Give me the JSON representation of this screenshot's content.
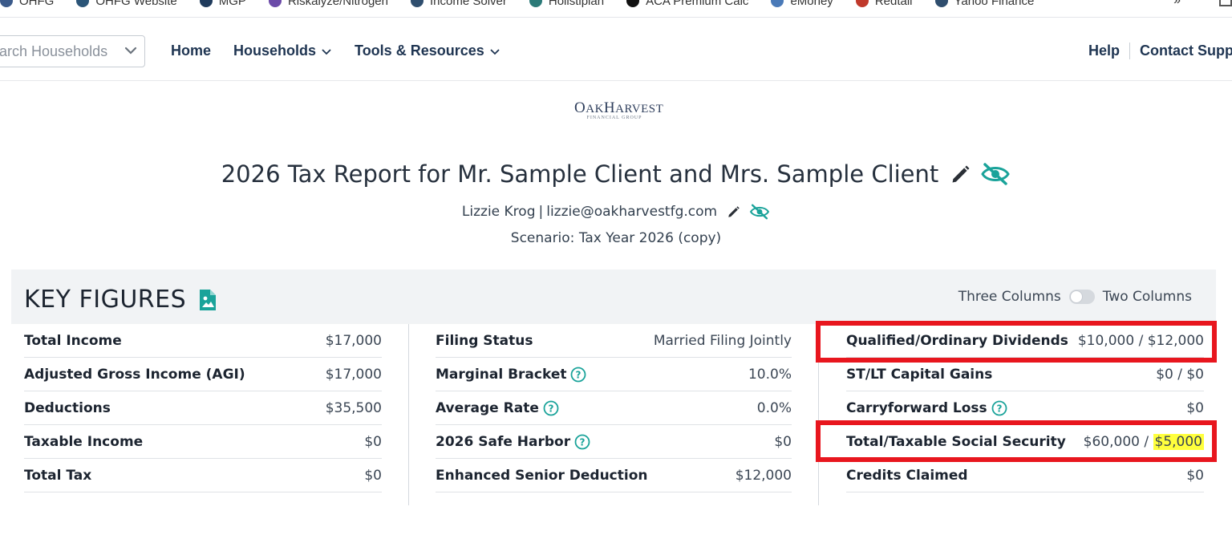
{
  "bookmarks": {
    "items": [
      {
        "label": "OHFG",
        "icon": "ohfg-icon",
        "color": "#3b5a8a"
      },
      {
        "label": "OHFG Website",
        "icon": "ohfg-website-icon",
        "color": "#2b5578"
      },
      {
        "label": "MGP",
        "icon": "mgp-icon",
        "color": "#1f3b5c"
      },
      {
        "label": "Riskalyze/Nitrogen",
        "icon": "nitrogen-icon",
        "color": "#6b4aa8"
      },
      {
        "label": "Income Solver",
        "icon": "income-solver-icon",
        "color": "#2f4e6e"
      },
      {
        "label": "Holistiplan",
        "icon": "holistiplan-icon",
        "color": "#2b7a78"
      },
      {
        "label": "ACA Premium Calc",
        "icon": "kff-icon",
        "color": "#111111"
      },
      {
        "label": "eMoney",
        "icon": "emoney-icon",
        "color": "#4a7ab8"
      },
      {
        "label": "Redtail",
        "icon": "redtail-icon",
        "color": "#c0392b"
      },
      {
        "label": "Yahoo Finance",
        "icon": "yahoo-icon",
        "color": "#2f4e6e"
      }
    ],
    "more": "»"
  },
  "navbar": {
    "search_placeholder": "Search Households",
    "links": {
      "home": "Home",
      "households": "Households",
      "tools": "Tools & Resources"
    },
    "help": "Help",
    "contact": "Contact Support"
  },
  "logo": {
    "main_first": "O",
    "main_rest": "AK",
    "main_second": "H",
    "main_second_rest": "ARVEST",
    "sub": "FINANCIAL GROUP"
  },
  "report": {
    "title": "2026 Tax Report for Mr. Sample Client and Mrs. Sample Client",
    "advisor_name": "Lizzie Krog",
    "separator": "|",
    "advisor_email": "lizzie@oakharvestfg.com",
    "scenario": "Scenario: Tax Year 2026 (copy)"
  },
  "key_figures": {
    "title": "KEY FIGURES",
    "toggle_left": "Three Columns",
    "toggle_right": "Two Columns",
    "columns": [
      [
        {
          "label": "Total Income",
          "value": "$17,000"
        },
        {
          "label": "Adjusted Gross Income (AGI)",
          "value": "$17,000"
        },
        {
          "label": "Deductions",
          "value": "$35,500"
        },
        {
          "label": "Taxable Income",
          "value": "$0"
        },
        {
          "label": "Total Tax",
          "value": "$0"
        }
      ],
      [
        {
          "label": "Filing Status",
          "value": "Married Filing Jointly"
        },
        {
          "label": "Marginal Bracket",
          "value": "10.0%"
        },
        {
          "label": "Average Rate",
          "value": "0.0%"
        },
        {
          "label": "2026 Safe Harbor",
          "value": "$0"
        },
        {
          "label": "Enhanced Senior Deduction",
          "value": "$12,000"
        }
      ],
      [
        {
          "label": "Qualified/Ordinary Dividends",
          "value": "$10,000 / $12,000"
        },
        {
          "label": "ST/LT Capital Gains",
          "value": "$0 / $0"
        },
        {
          "label": "Carryforward Loss",
          "value": "$0"
        },
        {
          "label": "Total/Taxable Social Security",
          "value_prefix": "$60,000 / ",
          "value_highlight": "$5,000"
        },
        {
          "label": "Credits Claimed",
          "value": "$0"
        }
      ]
    ]
  },
  "colors": {
    "accent_teal": "#1aa39a",
    "nav_text": "#1f3552",
    "highlight": "#ffff3c",
    "annotation_red": "#e8161e"
  }
}
